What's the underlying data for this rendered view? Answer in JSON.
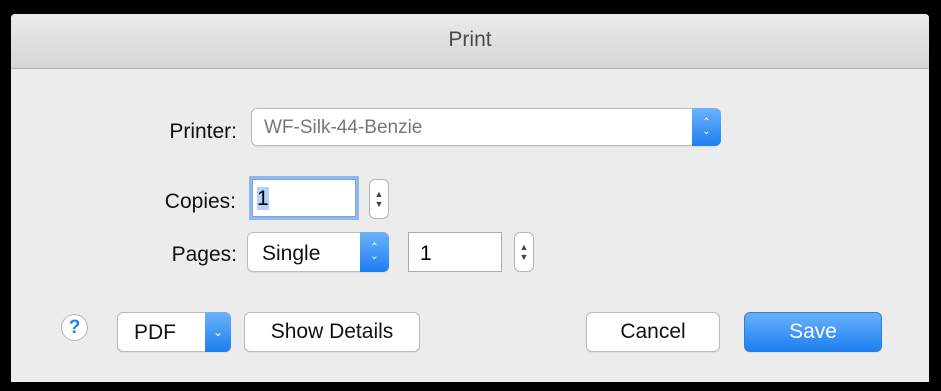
{
  "window": {
    "title": "Print"
  },
  "printer": {
    "label": "Printer:",
    "value": "WF-Silk-44-Benzie"
  },
  "copies": {
    "label": "Copies:",
    "value": "1"
  },
  "pages": {
    "label": "Pages:",
    "mode": "Single",
    "value": "1"
  },
  "buttons": {
    "help": "?",
    "pdf": "PDF",
    "show_details": "Show Details",
    "cancel": "Cancel",
    "save": "Save"
  },
  "icons": {
    "up_down": "updown-chevron-icon",
    "down": "chevron-down-icon"
  },
  "colors": {
    "accent": "#1d7ff0",
    "field_focus": "#8fb8ee",
    "selection": "#b4d2f6"
  }
}
